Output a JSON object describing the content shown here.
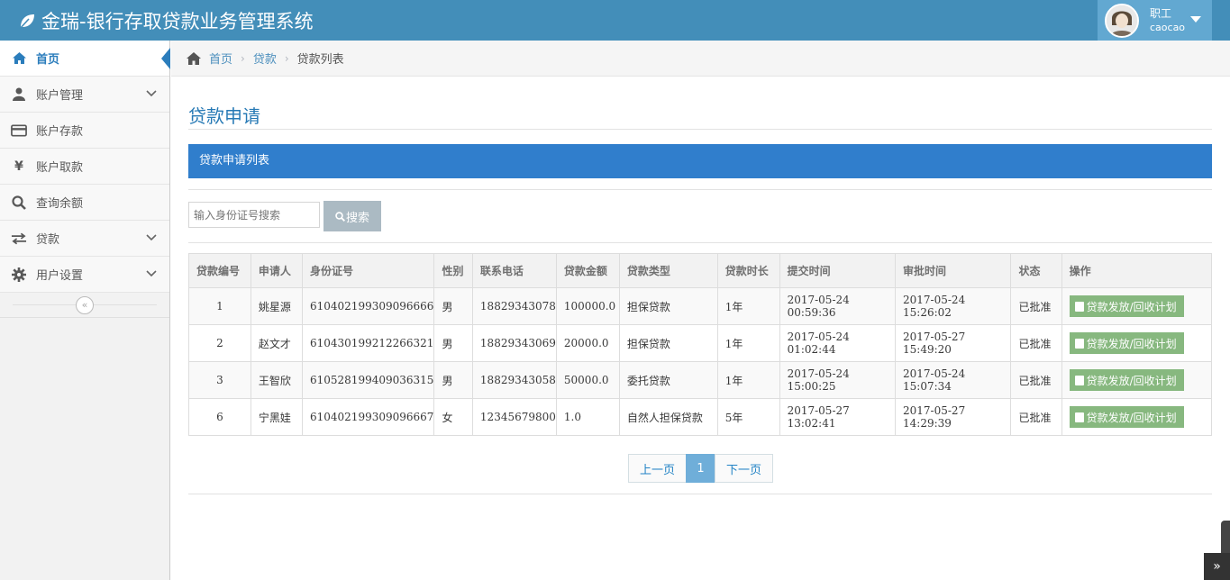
{
  "app": {
    "title": "金瑞-银行存取贷款业务管理系统"
  },
  "user": {
    "role": "职工",
    "name": "caocao"
  },
  "sidebar": {
    "items": [
      {
        "label": "首页",
        "icon": "home-icon"
      },
      {
        "label": "账户管理",
        "icon": "user-icon"
      },
      {
        "label": "账户存款",
        "icon": "credit-card-icon"
      },
      {
        "label": "账户取款",
        "icon": "yen-icon"
      },
      {
        "label": "查询余额",
        "icon": "search-icon"
      },
      {
        "label": "贷款",
        "icon": "exchange-icon"
      },
      {
        "label": "用户设置",
        "icon": "gear-icon"
      }
    ]
  },
  "breadcrumb": {
    "home": "首页",
    "loan": "贷款",
    "current": "贷款列表"
  },
  "page": {
    "title": "贷款申请",
    "list_title": "贷款申请列表",
    "search_placeholder": "输入身份证号搜索",
    "search_label": "搜索"
  },
  "table": {
    "headers": [
      "贷款编号",
      "申请人",
      "身份证号",
      "性别",
      "联系电话",
      "贷款金额",
      "贷款类型",
      "贷款时长",
      "提交时间",
      "审批时间",
      "状态",
      "操作"
    ],
    "rows": [
      [
        "1",
        "姚星源",
        "610402199309096666",
        "男",
        "18829343078",
        "100000.0",
        "担保贷款",
        "1年",
        "2017-05-24 00:59:36",
        "2017-05-24 15:26:02",
        "已批准",
        "贷款发放/回收计划"
      ],
      [
        "2",
        "赵文才",
        "610430199212266321",
        "男",
        "18829343069",
        "20000.0",
        "担保贷款",
        "1年",
        "2017-05-24 01:02:44",
        "2017-05-27 15:49:20",
        "已批准",
        "贷款发放/回收计划"
      ],
      [
        "3",
        "王智欣",
        "610528199409036315",
        "男",
        "18829343058",
        "50000.0",
        "委托贷款",
        "1年",
        "2017-05-24 15:00:25",
        "2017-05-24 15:07:34",
        "已批准",
        "贷款发放/回收计划"
      ],
      [
        "6",
        "宁黑娃",
        "610402199309096667",
        "女",
        "12345679800",
        "1.0",
        "自然人担保贷款",
        "5年",
        "2017-05-27 13:02:41",
        "2017-05-27 14:29:39",
        "已批准",
        "贷款发放/回收计划"
      ]
    ]
  },
  "pager": {
    "prev": "上一页",
    "current": "1",
    "next": "下一页"
  },
  "colors": {
    "navbar": "#438eb9",
    "accent": "#307ecc",
    "op_button": "#87b87f"
  }
}
